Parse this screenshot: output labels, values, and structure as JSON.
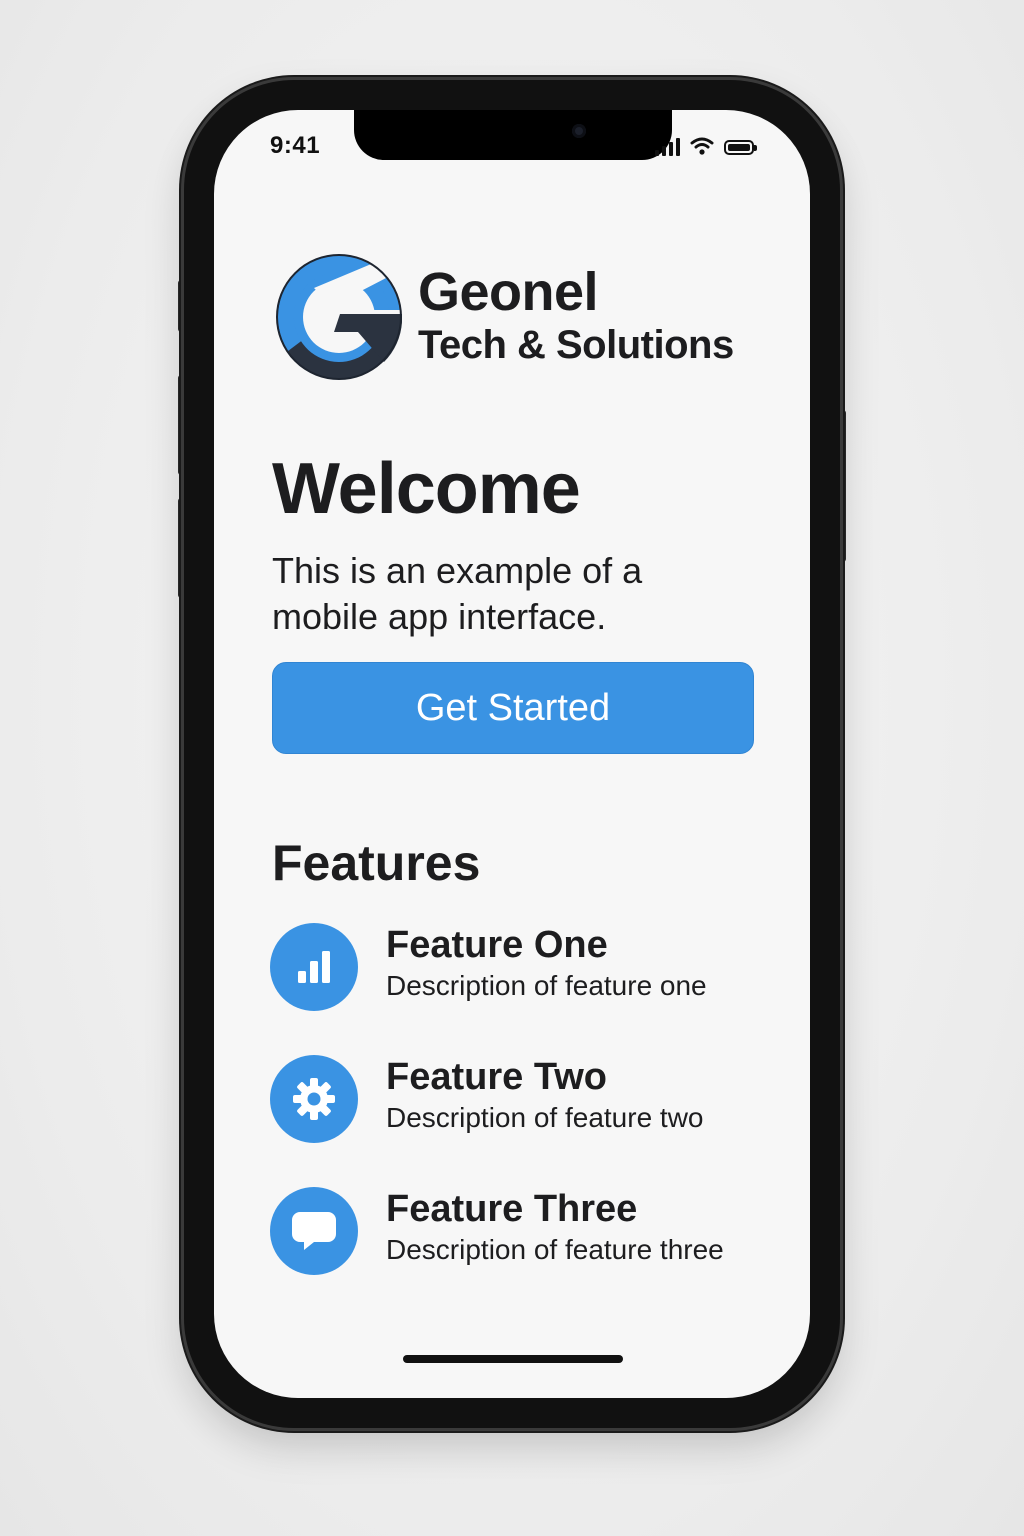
{
  "status_bar": {
    "time": "9:41",
    "icons": [
      "cellular-signal-icon",
      "wifi-icon",
      "battery-icon"
    ]
  },
  "brand": {
    "logo_icon": "geonel-g-logo-icon",
    "name": "Geonel",
    "tagline": "Tech & Solutions"
  },
  "welcome": {
    "title": "Welcome",
    "subtitle": "This is an example of a mobile app interface."
  },
  "cta": {
    "label": "Get Started"
  },
  "features": {
    "heading": "Features",
    "items": [
      {
        "icon": "bar-chart-icon",
        "title": "Feature One",
        "description": "Description of feature one"
      },
      {
        "icon": "gear-icon",
        "title": "Feature Two",
        "description": "Description of feature two"
      },
      {
        "icon": "chat-bubble-icon",
        "title": "Feature Three",
        "description": "Description of feature three"
      }
    ]
  },
  "colors": {
    "accent": "#3a93e3",
    "logo_dark": "#2b3340",
    "text": "#1d1d1f",
    "screen_bg": "#f7f7f7"
  }
}
